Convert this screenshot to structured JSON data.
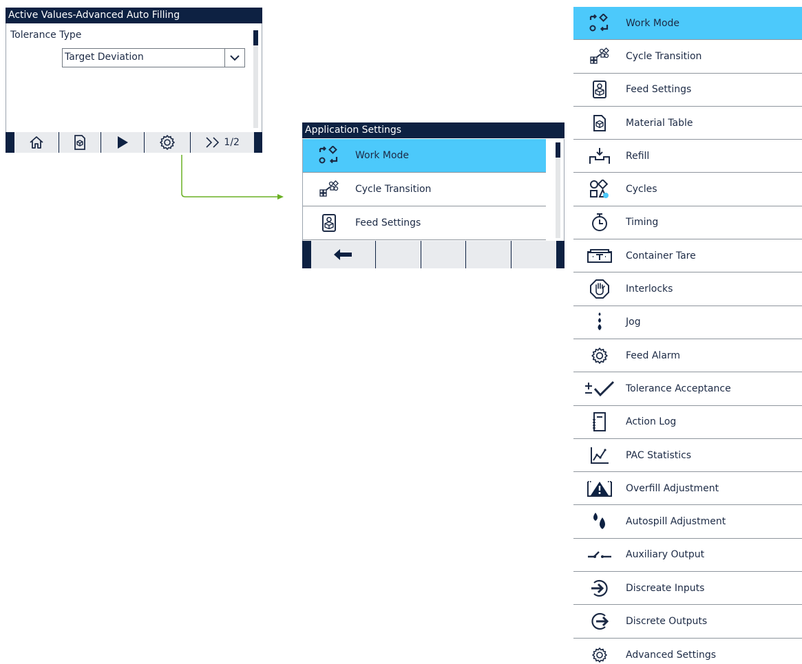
{
  "active_values": {
    "title": "Active Values-Advanced Auto Filling",
    "field_label": "Tolerance Type",
    "dropdown_value": "Target Deviation",
    "softkeys": {
      "home": "home-icon",
      "material": "material-table-icon",
      "start": "play-icon",
      "settings": "gear-icon",
      "next_page": "double-chevron-right-icon",
      "page_indicator": "1/2"
    }
  },
  "application_settings": {
    "title": "Application Settings",
    "items": [
      {
        "label": "Work Mode",
        "icon": "work-mode-icon",
        "selected": true
      },
      {
        "label": "Cycle Transition",
        "icon": "cycle-transition-icon"
      },
      {
        "label": "Feed Settings",
        "icon": "feed-settings-icon"
      }
    ],
    "softkeys": {
      "back": "back-arrow-icon"
    }
  },
  "full_menu": {
    "items": [
      {
        "label": "Work Mode",
        "icon": "work-mode-icon",
        "selected": true
      },
      {
        "label": "Cycle Transition",
        "icon": "cycle-transition-icon"
      },
      {
        "label": "Feed Settings",
        "icon": "feed-settings-icon"
      },
      {
        "label": "Material Table",
        "icon": "material-table-icon"
      },
      {
        "label": "Refill",
        "icon": "refill-icon"
      },
      {
        "label": "Cycles",
        "icon": "cycles-icon"
      },
      {
        "label": "Timing",
        "icon": "stopwatch-icon"
      },
      {
        "label": "Container Tare",
        "icon": "container-tare-icon"
      },
      {
        "label": "Interlocks",
        "icon": "hand-stop-icon"
      },
      {
        "label": "Jog",
        "icon": "jog-drops-icon"
      },
      {
        "label": "Feed Alarm",
        "icon": "gear-icon"
      },
      {
        "label": "Tolerance Acceptance",
        "icon": "plus-minus-check-icon"
      },
      {
        "label": "Action Log",
        "icon": "log-book-icon"
      },
      {
        "label": "PAC Statistics",
        "icon": "line-graph-icon"
      },
      {
        "label": "Overfill Adjustment",
        "icon": "warning-triangle-icon"
      },
      {
        "label": "Autospill Adjustment",
        "icon": "drops-icon"
      },
      {
        "label": "Auxiliary Output",
        "icon": "switch-icon"
      },
      {
        "label": "Discreate Inputs",
        "icon": "input-arrow-icon"
      },
      {
        "label": "Discrete Outputs",
        "icon": "output-arrow-icon"
      },
      {
        "label": "Advanced Settings",
        "icon": "gear-icon"
      }
    ]
  },
  "colors": {
    "title_bar": "#0d2142",
    "selected_row": "#4cc9fb",
    "connector": "#6ab023",
    "icon": "#1c2a45"
  }
}
